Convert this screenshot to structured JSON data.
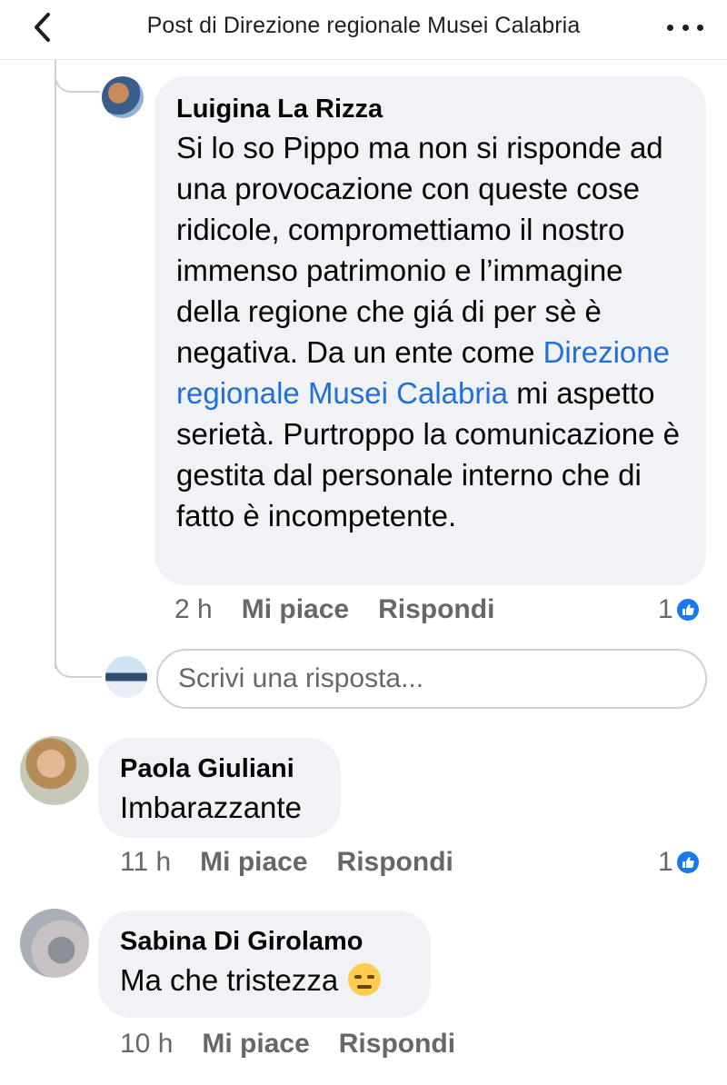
{
  "header": {
    "title": "Post di Direzione regionale Musei Calabria",
    "back_icon": "chevron-left-icon",
    "more_icon": "more-horizontal-icon"
  },
  "comments": [
    {
      "author": "Luigina La Rizza",
      "text_before": "Si lo so Pippo ma non si risponde ad una provocazione con queste cose ridicole, compromettiamo il nostro immenso patrimonio e l’immagine della regione che giá di per sè è negativa. Da un ente come ",
      "mention": "Direzione regionale Musei Calabria",
      "text_after": " mi aspetto serietà. Purtroppo la comunicazione è gestita dal personale interno che di fatto è incompetente.",
      "time": "2 h",
      "like_label": "Mi piace",
      "reply_label": "Rispondi",
      "like_count": "1"
    },
    {
      "author": "Paola Giuliani",
      "text": "Imbarazzante",
      "time": "11 h",
      "like_label": "Mi piace",
      "reply_label": "Rispondi",
      "like_count": "1"
    },
    {
      "author": "Sabina Di Girolamo",
      "text": "Ma che tristezza",
      "emoji": "expressionless-face",
      "time": "10 h",
      "like_label": "Mi piace",
      "reply_label": "Rispondi"
    }
  ],
  "reply_box": {
    "placeholder": "Scrivi una risposta..."
  },
  "colors": {
    "link": "#216fdb",
    "like_badge": "#1877f2",
    "bubble": "#f0f2f5",
    "meta_text": "#65676b"
  }
}
